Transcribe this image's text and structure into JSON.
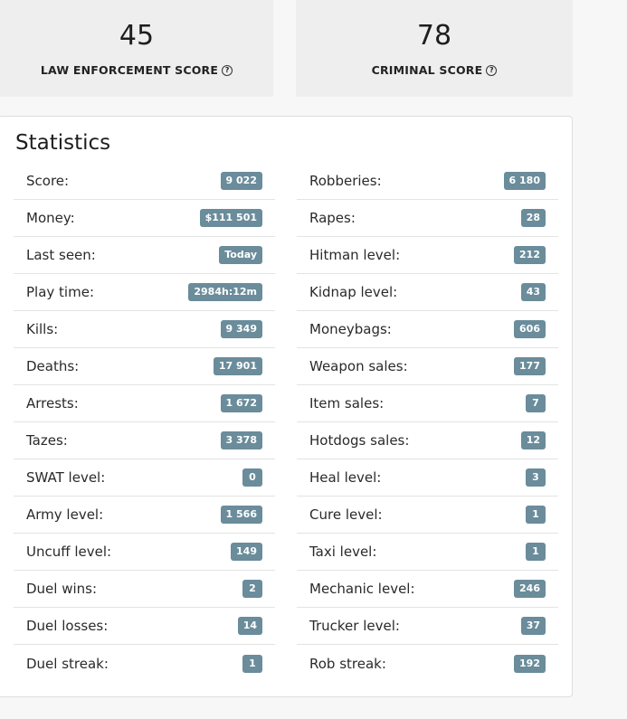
{
  "scores": {
    "law": {
      "value": "45",
      "label": "LAW ENFORCEMENT SCORE"
    },
    "criminal": {
      "value": "78",
      "label": "CRIMINAL SCORE"
    }
  },
  "stats": {
    "title": "Statistics",
    "left": [
      {
        "label": "Score:",
        "value": "9 022"
      },
      {
        "label": "Money:",
        "value": "$111 501"
      },
      {
        "label": "Last seen:",
        "value": "Today"
      },
      {
        "label": "Play time:",
        "value": "2984h:12m"
      },
      {
        "label": "Kills:",
        "value": "9 349"
      },
      {
        "label": "Deaths:",
        "value": "17 901"
      },
      {
        "label": "Arrests:",
        "value": "1 672"
      },
      {
        "label": "Tazes:",
        "value": "3 378"
      },
      {
        "label": "SWAT level:",
        "value": "0"
      },
      {
        "label": "Army level:",
        "value": "1 566"
      },
      {
        "label": "Uncuff level:",
        "value": "149"
      },
      {
        "label": "Duel wins:",
        "value": "2"
      },
      {
        "label": "Duel losses:",
        "value": "14"
      },
      {
        "label": "Duel streak:",
        "value": "1"
      }
    ],
    "right": [
      {
        "label": "Robberies:",
        "value": "6 180"
      },
      {
        "label": "Rapes:",
        "value": "28"
      },
      {
        "label": "Hitman level:",
        "value": "212"
      },
      {
        "label": "Kidnap level:",
        "value": "43"
      },
      {
        "label": "Moneybags:",
        "value": "606"
      },
      {
        "label": "Weapon sales:",
        "value": "177"
      },
      {
        "label": "Item sales:",
        "value": "7"
      },
      {
        "label": "Hotdogs sales:",
        "value": "12"
      },
      {
        "label": "Heal level:",
        "value": "3"
      },
      {
        "label": "Cure level:",
        "value": "1"
      },
      {
        "label": "Taxi level:",
        "value": "1"
      },
      {
        "label": "Mechanic level:",
        "value": "246"
      },
      {
        "label": "Trucker level:",
        "value": "37"
      },
      {
        "label": "Rob streak:",
        "value": "192"
      }
    ]
  },
  "colors": {
    "badge": "#6a8c9b",
    "card_bg": "#eeeeee"
  },
  "icons": {
    "help": "question-circle-icon"
  }
}
